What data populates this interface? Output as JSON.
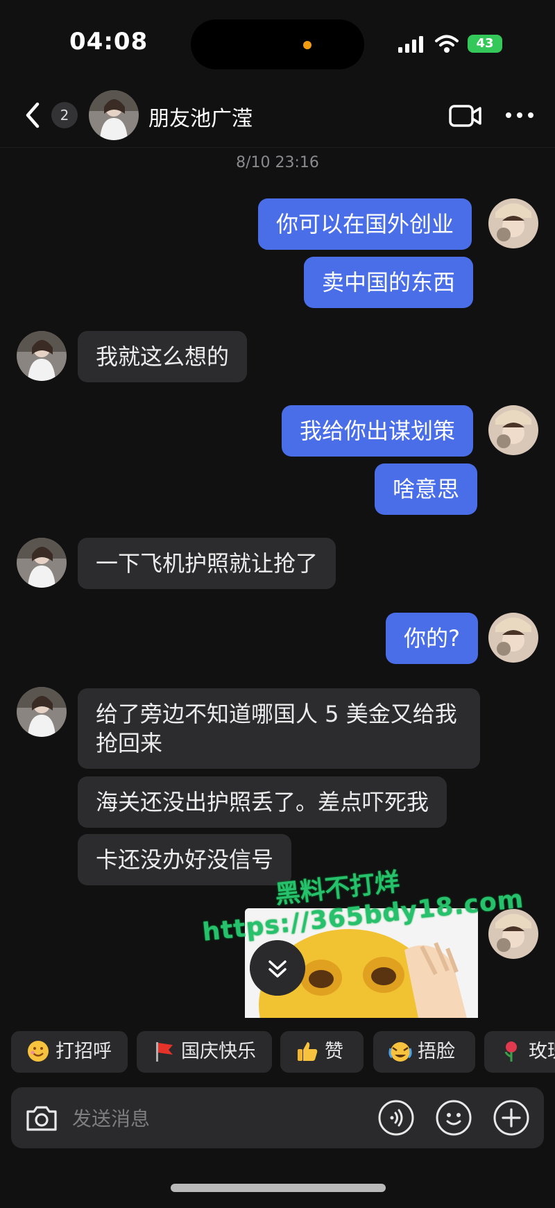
{
  "status_bar": {
    "time": "04:08",
    "battery": "43"
  },
  "header": {
    "back_badge": "2",
    "contact_name": "朋友池广滢"
  },
  "timestamp": "8/10 23:16",
  "messages": [
    {
      "side": "out",
      "text": "你可以在国外创业"
    },
    {
      "side": "out",
      "text": "卖中国的东西"
    },
    {
      "side": "in",
      "text": "我就这么想的"
    },
    {
      "side": "out",
      "text": "我给你出谋划策"
    },
    {
      "side": "out",
      "text": "啥意思"
    },
    {
      "side": "in",
      "text": "一下飞机护照就让抢了"
    },
    {
      "side": "out",
      "text": "你的?"
    },
    {
      "side": "in",
      "text": "给了旁边不知道哪国人 5 美金又给我抢回来"
    },
    {
      "side": "in",
      "text": "海关还没出护照丢了。差点吓死我"
    },
    {
      "side": "in",
      "text": "卡还没办好没信号"
    }
  ],
  "watermark": {
    "line1": "黑料不打烊",
    "line2": "https://365bdy18.com"
  },
  "quick_replies": [
    {
      "label": "打招呼",
      "icon": "smile-emoji-icon"
    },
    {
      "label": "国庆快乐",
      "icon": "red-flag-icon"
    },
    {
      "label": "赞",
      "icon": "thumbs-up-icon"
    },
    {
      "label": "捂脸",
      "icon": "facepalm-emoji-icon"
    },
    {
      "label": "玫瑰",
      "icon": "rose-icon"
    }
  ],
  "input": {
    "placeholder": "发送消息"
  },
  "colors": {
    "background": "#111112",
    "outgoing_bubble": "#4a6ee8",
    "incoming_bubble": "#2c2c2e",
    "watermark": "#27c06d"
  }
}
